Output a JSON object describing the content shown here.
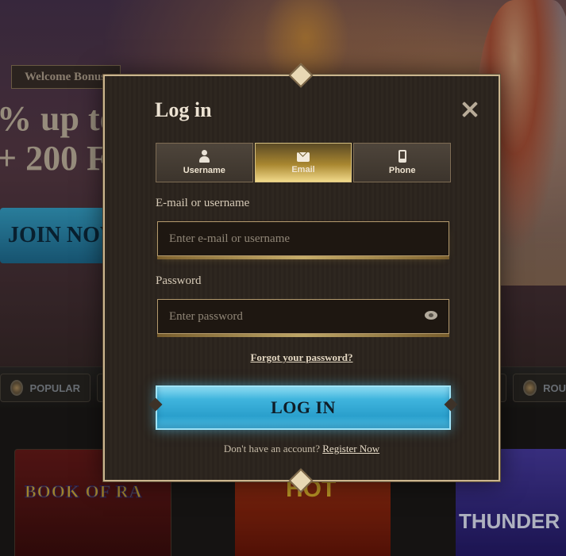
{
  "background": {
    "welcome_badge": "Welcome Bonus",
    "promo_line_1": "% up to",
    "promo_line_2": "+ 200 F",
    "join_button": "JOIN NOW",
    "categories": [
      {
        "label": "POPULAR",
        "icon": "flame-icon"
      },
      {
        "label": "ROU",
        "icon": "roulette-icon"
      }
    ],
    "games": [
      {
        "title": "BOOK OF RA",
        "color": "#6b1b1a"
      },
      {
        "title": "HOT",
        "color": "#b43a16"
      },
      {
        "title": "THUNDER",
        "color": "#4b3ea8"
      }
    ]
  },
  "modal": {
    "title": "Log in",
    "close_icon": "close-icon",
    "tabs": [
      {
        "label": "Username",
        "icon": "user-icon",
        "active": false
      },
      {
        "label": "Email",
        "icon": "mail-icon",
        "active": true
      },
      {
        "label": "Phone",
        "icon": "phone-icon",
        "active": false
      }
    ],
    "email_label": "E-mail or username",
    "email_placeholder": "Enter e-mail or username",
    "email_value": "",
    "password_label": "Password",
    "password_placeholder": "Enter password",
    "password_value": "",
    "forgot_link": "Forgot your password?",
    "login_button": "LOG IN",
    "no_account_text": "Don't have an account?",
    "register_link": "Register Now"
  },
  "colors": {
    "accent_gold": "#cbb58e",
    "login_button_blue": "#3fb4dd",
    "active_tab_gold": "#a98730"
  }
}
